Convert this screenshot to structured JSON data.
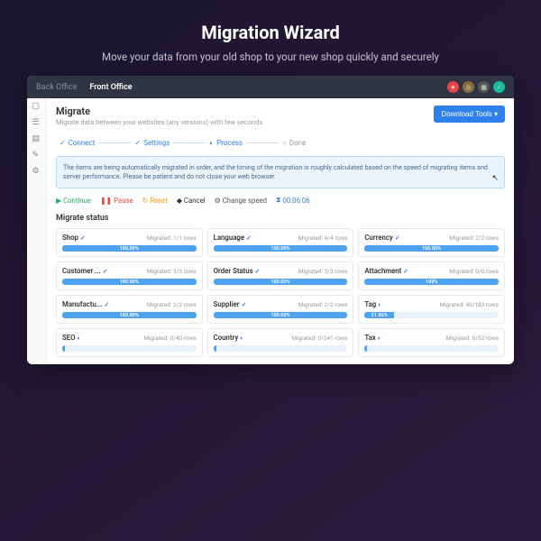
{
  "hero": {
    "title": "Migration Wizard",
    "subtitle": "Move your data from your old shop to your new shop quickly and securely"
  },
  "topbar": {
    "tabs": [
      {
        "label": "Back Office",
        "active": false
      },
      {
        "label": "Front Office",
        "active": true
      }
    ]
  },
  "header": {
    "title": "Migrate",
    "subtitle": "Migrate data between your websites (any versions) with few seconds",
    "download_btn": "Download Tools ▾"
  },
  "stepper": [
    {
      "label": "Connect",
      "status": "done"
    },
    {
      "label": "Settings",
      "status": "done"
    },
    {
      "label": "Process",
      "status": "active"
    },
    {
      "label": "Done",
      "status": "pending"
    }
  ],
  "notice": "The items are being automatically migrated in order, and the timing of the migration is roughly calculated based on the speed of migrating items and server performance. Please be patient and do not close your web browser.",
  "actions": {
    "continue": "Continue",
    "pause": "Pause",
    "reset": "Reset",
    "cancel": "Cancel",
    "change_speed": "Change speed",
    "elapsed": "00:06:06"
  },
  "status_title": "Migrate status",
  "cards": [
    {
      "title": "Shop",
      "done": true,
      "meta": "Migrated: 1/1 rows",
      "pct": 100,
      "pct_label": "100.00%"
    },
    {
      "title": "Language",
      "done": true,
      "meta": "Migrated: 4/4 rows",
      "pct": 100,
      "pct_label": "100.00%"
    },
    {
      "title": "Currency",
      "done": true,
      "meta": "Migrated: 2/2 rows",
      "pct": 100,
      "pct_label": "100.00%"
    },
    {
      "title": "Customer ...",
      "done": true,
      "meta": "Migrated: 3/3 rows",
      "pct": 100,
      "pct_label": "100.00%"
    },
    {
      "title": "Order Status",
      "done": true,
      "meta": "Migrated: 3/3 rows",
      "pct": 100,
      "pct_label": "100.00%"
    },
    {
      "title": "Attachment",
      "done": true,
      "meta": "Migrated: 0/0 rows",
      "pct": 100,
      "pct_label": "100%"
    },
    {
      "title": "Manufactu...",
      "done": true,
      "meta": "Migrated: 2/2 rows",
      "pct": 100,
      "pct_label": "100.00%"
    },
    {
      "title": "Supplier",
      "done": true,
      "meta": "Migrated: 2/2 rows",
      "pct": 100,
      "pct_label": "100.00%"
    },
    {
      "title": "Tag",
      "done": false,
      "meta": "Migrated: 40/183 rows",
      "pct": 22,
      "pct_label": "21.86%"
    },
    {
      "title": "SEO",
      "done": false,
      "meta": "Migrated: 0/40 rows",
      "pct": 2,
      "pct_label": ""
    },
    {
      "title": "Country",
      "done": false,
      "meta": "Migrated: 0/241 rows",
      "pct": 2,
      "pct_label": ""
    },
    {
      "title": "Tax",
      "done": false,
      "meta": "Migrated: 0/52 rows",
      "pct": 2,
      "pct_label": ""
    }
  ]
}
